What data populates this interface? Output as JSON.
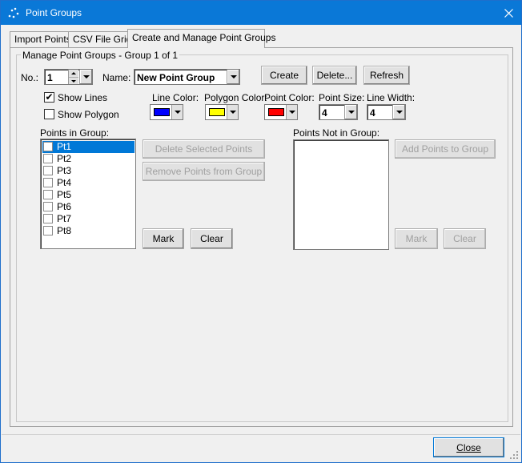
{
  "window": {
    "title": "Point Groups",
    "close_symbol": "✕"
  },
  "tabs": [
    {
      "label": "Import Points",
      "active": false
    },
    {
      "label": "CSV File Grid",
      "active": false
    },
    {
      "label": "Create and Manage Point Groups",
      "active": true
    }
  ],
  "group_box": {
    "legend": "Manage Point Groups - Group 1 of 1"
  },
  "number": {
    "label": "No.:",
    "value": "1"
  },
  "name": {
    "label": "Name:",
    "value": "New Point Group"
  },
  "buttons": {
    "create": "Create",
    "delete": "Delete...",
    "refresh": "Refresh",
    "delete_selected": "Delete Selected Points",
    "remove_from_group": "Remove Points from Group",
    "add_to_group": "Add Points to Group",
    "mark_left": "Mark",
    "clear_left": "Clear",
    "mark_right": "Mark",
    "clear_right": "Clear",
    "close": "Close"
  },
  "checkboxes": {
    "show_lines": {
      "label": "Show Lines",
      "checked": true
    },
    "show_polygon": {
      "label": "Show Polygon",
      "checked": false
    }
  },
  "line_color": {
    "label": "Line Color:",
    "color": "#0000ff"
  },
  "polygon_color": {
    "label": "Polygon Color:",
    "color": "#ffff00"
  },
  "point_color": {
    "label": "Point Color:",
    "color": "#ff0000"
  },
  "point_size": {
    "label": "Point Size:",
    "value": "4"
  },
  "line_width": {
    "label": "Line Width:",
    "value": "4"
  },
  "points_in_group": {
    "label": "Points in Group:",
    "items": [
      "Pt1",
      "Pt2",
      "Pt3",
      "Pt4",
      "Pt5",
      "Pt6",
      "Pt7",
      "Pt8"
    ],
    "selected_index": 0
  },
  "points_not_in_group": {
    "label": "Points Not in Group:",
    "items": []
  },
  "colors": {
    "title_bar": "#0a78d7",
    "selection": "#0078d7",
    "window_bg": "#f0f0f0"
  }
}
